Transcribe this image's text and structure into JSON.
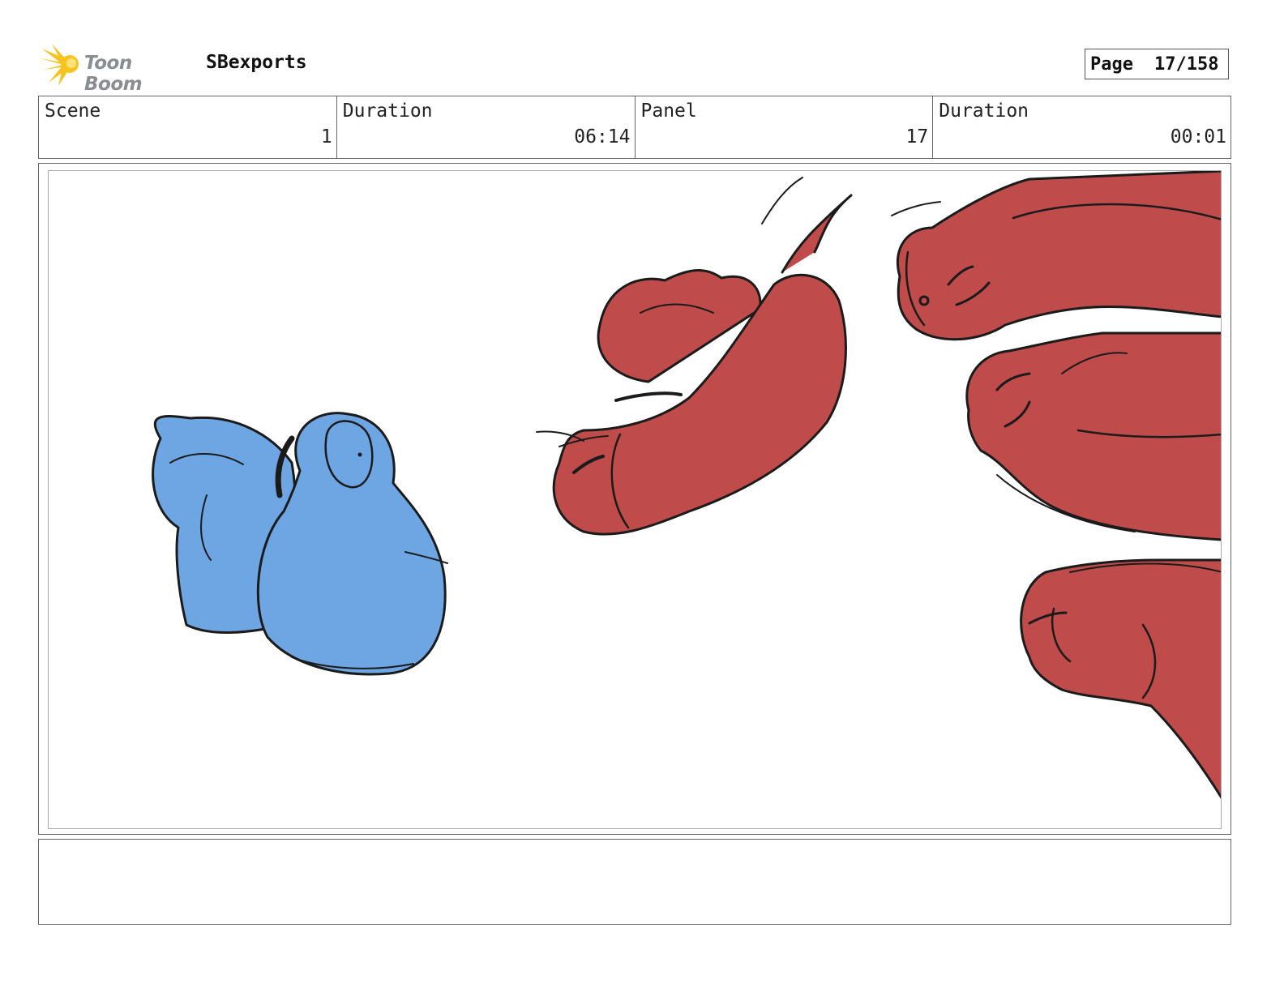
{
  "header": {
    "logo_text": "Toon Boom",
    "project_name": "SBexports",
    "page_label": "Page",
    "page_value": "17/158"
  },
  "info": {
    "scene_label": "Scene",
    "scene_value": "1",
    "scene_duration_label": "Duration",
    "scene_duration_value": "06:14",
    "panel_label": "Panel",
    "panel_value": "17",
    "panel_duration_label": "Duration",
    "panel_duration_value": "00:01"
  },
  "colors": {
    "logo_yellow": "#f7c31e",
    "character_blue": "#6ea6e4",
    "character_red": "#c04b4b",
    "sketch_line": "#1b1b1b"
  },
  "panel_image": {
    "icon": "storyboard-sketch"
  },
  "notes": {
    "text": ""
  }
}
